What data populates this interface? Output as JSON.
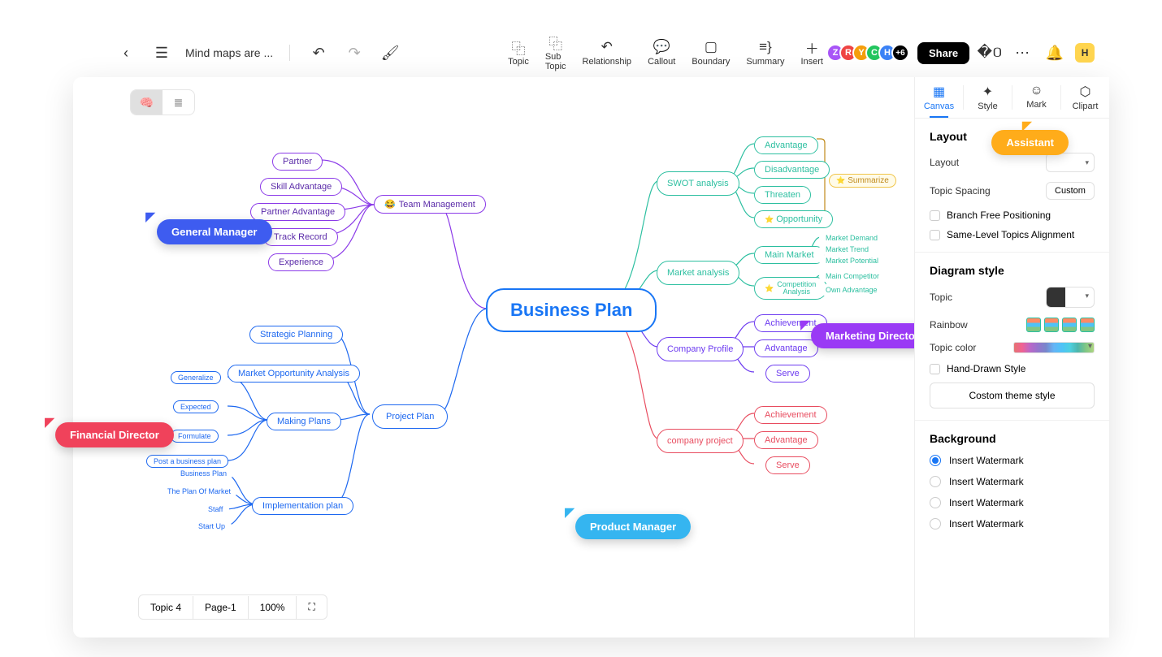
{
  "header": {
    "doc_title": "Mind maps are ...",
    "tools": [
      {
        "id": "topic",
        "label": "Topic",
        "icon": "⿻"
      },
      {
        "id": "subtopic",
        "label": "Sub Topic",
        "icon": "⿻"
      },
      {
        "id": "relationship",
        "label": "Relationship",
        "icon": "↶"
      },
      {
        "id": "callout",
        "label": "Callout",
        "icon": "💬"
      },
      {
        "id": "boundary",
        "label": "Boundary",
        "icon": "▢"
      },
      {
        "id": "summary",
        "label": "Summary",
        "icon": "≡}"
      },
      {
        "id": "insert",
        "label": "Insert",
        "icon": "＋"
      }
    ],
    "avatars": [
      {
        "letter": "Z",
        "color": "#a855f7"
      },
      {
        "letter": "R",
        "color": "#ef4444"
      },
      {
        "letter": "Y",
        "color": "#f59e0b"
      },
      {
        "letter": "C",
        "color": "#22c55e"
      },
      {
        "letter": "H",
        "color": "#3b82f6"
      }
    ],
    "avatar_extra": "+6",
    "share": "Share",
    "me": "H"
  },
  "mindmap": {
    "root": "Business Plan",
    "left": {
      "team": {
        "label": "Team Management",
        "children": [
          "Partner",
          "Skill Advantage",
          "Partner Advantage",
          "Track Record",
          "Experience"
        ]
      },
      "project": {
        "label": "Project Plan",
        "children": [
          {
            "label": "Strategic Planning"
          },
          {
            "label": "Market Opportunity Analysis"
          },
          {
            "label": "Making Plans",
            "sub": [
              "Generalize",
              "Expected",
              "Formulate",
              "Post a business plan"
            ]
          },
          {
            "label": "Implementation plan",
            "sub": [
              "Business Plan",
              "The Plan Of Market",
              "Staff",
              "Start Up"
            ]
          }
        ]
      }
    },
    "right": {
      "swot": {
        "label": "SWOT analysis",
        "children": [
          "Advantage",
          "Disadvantage",
          "Threaten",
          "Opportunity"
        ],
        "summary": "Summarize"
      },
      "market": {
        "label": "Market analysis",
        "children": [
          {
            "label": "Main Market",
            "sub": [
              "Market Demand",
              "Market Trend",
              "Market Potential"
            ]
          },
          {
            "label": "Competition Analysis",
            "sub": [
              "Main Competitor",
              "Own Advantage"
            ]
          }
        ]
      },
      "profile": {
        "label": "Company Profile",
        "children": [
          "Achievement",
          "Advantage",
          "Serve"
        ]
      },
      "project": {
        "label": "company project",
        "children": [
          "Achievement",
          "Advantage",
          "Serve"
        ]
      }
    }
  },
  "cursors": {
    "general": "General Manager",
    "financial": "Financial Director",
    "marketing": "Marketing Director",
    "product": "Product Manager"
  },
  "footer": {
    "topic": "Topic 4",
    "page": "Page-1",
    "zoom": "100%"
  },
  "panel": {
    "tabs": [
      "Canvas",
      "Style",
      "Mark",
      "Clipart"
    ],
    "layout_title": "Layout",
    "layout_label": "Layout",
    "spacing_label": "Topic Spacing",
    "spacing_value": "Custom",
    "branch_free": "Branch Free Positioning",
    "same_level": "Same-Level Topics Alignment",
    "diagram_title": "Diagram style",
    "topic_label": "Topic",
    "rainbow_label": "Rainbow",
    "topiccolor_label": "Topic color",
    "handdrawn": "Hand-Drawn Style",
    "custom_theme": "Costom theme style",
    "background_title": "Background",
    "bg_options": [
      "Insert Watermark",
      "Insert Watermark",
      "Insert Watermark",
      "Insert Watermark"
    ]
  },
  "assistant": "Assistant"
}
